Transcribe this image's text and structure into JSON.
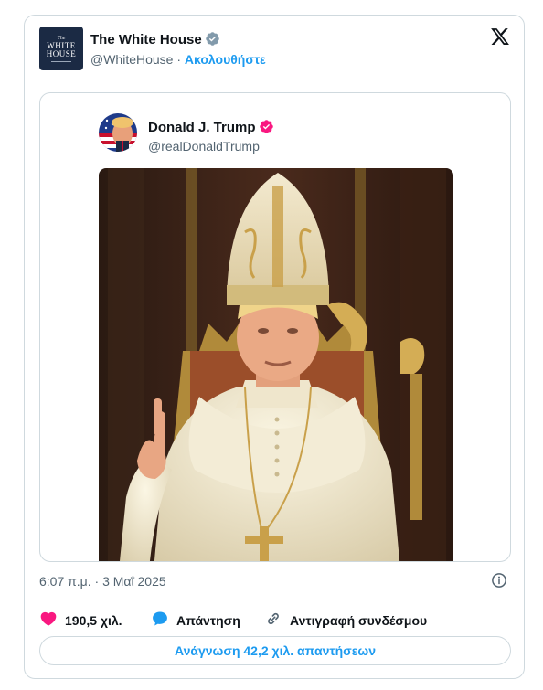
{
  "author": {
    "name": "The White House",
    "handle": "@WhiteHouse",
    "separator": "·",
    "follow_label": "Ακολουθήστε",
    "logo_lines": [
      "The",
      "WHITE",
      "HOUSE"
    ]
  },
  "quoted": {
    "name": "Donald J. Trump",
    "handle": "@realDonaldTrump"
  },
  "timestamp": "6:07 π.μ. · 3 Μαΐ 2025",
  "actions": {
    "likes_count": "190,5 χιλ.",
    "reply_label": "Απάντηση",
    "copy_link_label": "Αντιγραφή συνδέσμου"
  },
  "read_replies_label": "Ανάγνωση 42,2 χιλ. απαντήσεων",
  "colors": {
    "accent": "#1d9bf0",
    "like": "#f91880",
    "verified_gray": "#829aab",
    "verified_pink": "#f91880",
    "text_secondary": "#536471",
    "border": "#cfd9de"
  },
  "icons": [
    "x-logo-icon",
    "verified-badge-icon",
    "info-icon",
    "heart-icon",
    "speech-bubble-icon",
    "link-icon"
  ]
}
